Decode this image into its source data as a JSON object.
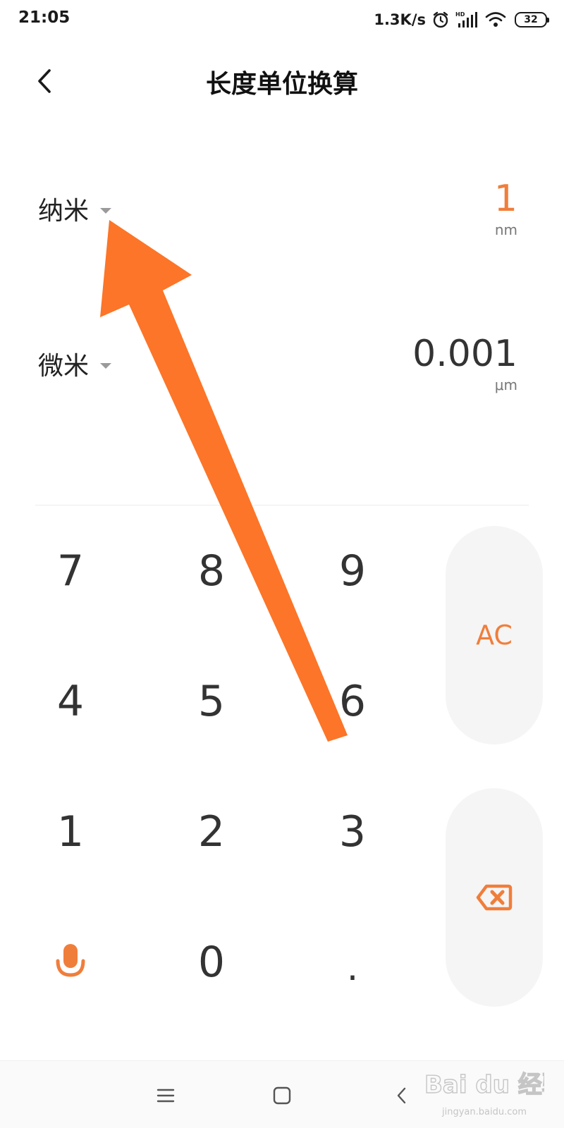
{
  "status_bar": {
    "time": "21:05",
    "net_speed": "1.3K/s",
    "battery": "32",
    "icons": [
      "alarm-clock-icon",
      "hd-signal-icon",
      "wifi-icon",
      "battery-icon"
    ]
  },
  "header": {
    "title": "长度单位换算",
    "back_icon": "chevron-left-icon"
  },
  "converter": {
    "from": {
      "unit_name": "纳米",
      "value": "1",
      "unit_symbol": "nm",
      "active": true
    },
    "to": {
      "unit_name": "微米",
      "value": "0.001",
      "unit_symbol": "μm",
      "active": false
    }
  },
  "keypad": {
    "digits": [
      "7",
      "8",
      "9",
      "4",
      "5",
      "6",
      "1",
      "2",
      "3"
    ],
    "zero": "0",
    "decimal": ".",
    "clear_label": "AC",
    "voice_icon": "microphone-icon",
    "backspace_icon": "backspace-icon"
  },
  "nav_bar": {
    "icons": [
      "menu-icon",
      "home-square-icon",
      "back-chevron-icon"
    ]
  },
  "watermark": {
    "brand": "Bai du 经验",
    "url": "jingyan.baidu.com"
  },
  "colors": {
    "accent": "#f07e3b",
    "key_bg": "#f5f5f5",
    "text": "#333333",
    "annotation_arrow": "#fc7528"
  }
}
